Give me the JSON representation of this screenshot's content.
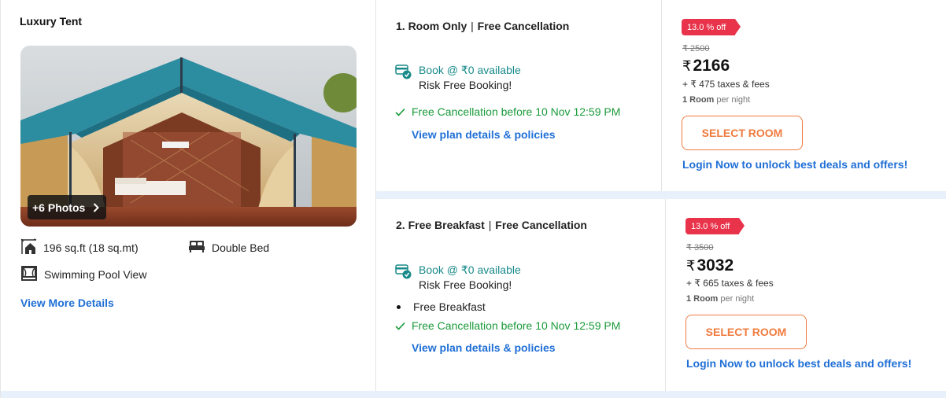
{
  "room": {
    "title": "Luxury Tent",
    "photos_label": "+6 Photos",
    "amenities": {
      "area": "196 sq.ft (18 sq.mt)",
      "bed": "Double Bed",
      "view": "Swimming Pool View"
    },
    "more_details": "View More Details"
  },
  "plans": [
    {
      "title_a": "1. Room Only",
      "separator": "|",
      "title_b": "Free Cancellation",
      "book_line": "Book @ ₹0 available",
      "risk_line": "Risk Free Booking!",
      "cancellation": "Free Cancellation before 10 Nov 12:59 PM",
      "details_link": "View plan details & policies",
      "discount": "13.0 % off",
      "original_price": "₹ 2500",
      "currency": "₹",
      "price": "2166",
      "taxes": "+ ₹ 475 taxes & fees",
      "rooms": "1 Room",
      "per_night": "per night",
      "select_label": "SELECT ROOM",
      "login_text": "Login Now to unlock best deals and offers!"
    },
    {
      "title_a": "2. Free Breakfast",
      "separator": "|",
      "title_b": "Free Cancellation",
      "book_line": "Book @ ₹0 available",
      "risk_line": "Risk Free Booking!",
      "inclusion": "Free Breakfast",
      "cancellation": "Free Cancellation before 10 Nov 12:59 PM",
      "details_link": "View plan details & policies",
      "discount": "13.0 % off",
      "original_price": "₹ 3500",
      "currency": "₹",
      "price": "3032",
      "taxes": "+ ₹ 665 taxes & fees",
      "rooms": "1 Room",
      "per_night": "per night",
      "select_label": "SELECT ROOM",
      "login_text": "Login Now to unlock best deals and offers!"
    }
  ],
  "colors": {
    "accent_orange": "#f07b3f",
    "link_blue": "#1f6fd6",
    "badge_red": "#e8334a",
    "teal": "#1a8a8a",
    "green": "#1a9a3a"
  }
}
